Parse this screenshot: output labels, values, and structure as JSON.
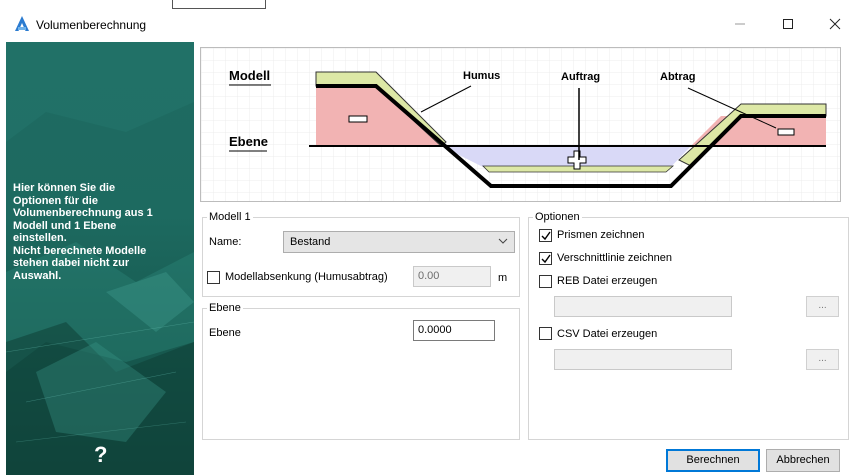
{
  "window": {
    "title": "Volumenberechnung"
  },
  "sidebar": {
    "description": "Hier können Sie die\nOptionen für die\nVolumenberechnung aus 1\nModell und 1 Ebene\neinstellen.\nNicht berechnete Modelle\nstehen dabei nicht zur\nAuswahl.",
    "help_symbol": "?"
  },
  "diagram": {
    "label_model": "Modell",
    "label_plane": "Ebene",
    "label_humus": "Humus",
    "label_fill": "Auftrag",
    "label_cut": "Abtrag"
  },
  "model_group": {
    "title": "Modell 1",
    "name_label": "Name:",
    "name_value": "Bestand",
    "lowering_label": "Modellabsenkung (Humusabtrag)",
    "lowering_checked": false,
    "lowering_value": "0.00",
    "lowering_unit": "m"
  },
  "plane_group": {
    "title": "Ebene",
    "label": "Ebene",
    "value": "0.0000"
  },
  "options_group": {
    "title": "Optionen",
    "prisms_label": "Prismen zeichnen",
    "prisms_checked": true,
    "cutline_label": "Verschnittlinie zeichnen",
    "cutline_checked": true,
    "reb_label": "REB Datei erzeugen",
    "reb_checked": false,
    "reb_path": "",
    "reb_browse": "...",
    "csv_label": "CSV Datei erzeugen",
    "csv_checked": false,
    "csv_path": "",
    "csv_browse": "..."
  },
  "buttons": {
    "compute": "Berechnen",
    "cancel": "Abbrechen"
  },
  "colors": {
    "sidebar_bg": "#1d6a60",
    "primary_border": "#0078d7",
    "cut_fill": "#f2b3b3",
    "fill_fill": "#d9d9f7",
    "humus_fill": "#dde8a6"
  }
}
